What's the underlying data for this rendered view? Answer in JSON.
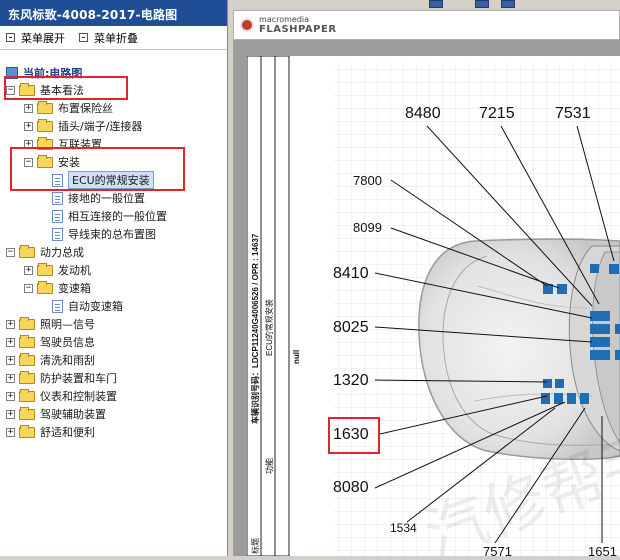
{
  "window": {
    "title": "东风标致-4008-2017-电路图"
  },
  "menu": {
    "expand_label": "菜单展开",
    "collapse_label": "菜单折叠"
  },
  "tree": {
    "root": "当前:电路图",
    "basic": "基本看法",
    "items": {
      "fuse": "布置保险丝",
      "connectors": "插头/端子/连接器",
      "interconnect": "互联装置",
      "install": "安装",
      "ecu": "ECU的常规安装",
      "ground": "接地的一般位置",
      "mutual": "相互连接的一般位置",
      "wiring": "导线束的总布置图",
      "powertrain": "动力总成",
      "engine": "发动机",
      "gearbox": "变速箱",
      "autogearbox": "自动变速箱",
      "lighting": "照明—信号",
      "driver_info": "驾驶员信息",
      "wash": "清洗和雨刮",
      "protect": "防护装置和车门",
      "dashboard": "仪表和控制装置",
      "assist": "驾驶辅助装置",
      "comfort": "舒适和便利"
    }
  },
  "flash": {
    "brand_small": "macromedia",
    "brand_big": "FLASHPAPER"
  },
  "diagram": {
    "vin_label": "车辆识别号码：LDCP11240G4006526 / OPR : 14637",
    "func_label": "功能",
    "func_value": "ECU的常规安装",
    "null_text": "null",
    "title_bottom": "标题",
    "labels": [
      "8480",
      "7215",
      "7531",
      "7800",
      "8099",
      "8410",
      "8025",
      "1320",
      "1630",
      "8080",
      "1534",
      "7571",
      "1651"
    ],
    "watermark": "汽修帮手"
  },
  "colors": {
    "title_bar": "#1f4e96",
    "highlight": "#e0252b",
    "module": "#1f6db5"
  }
}
